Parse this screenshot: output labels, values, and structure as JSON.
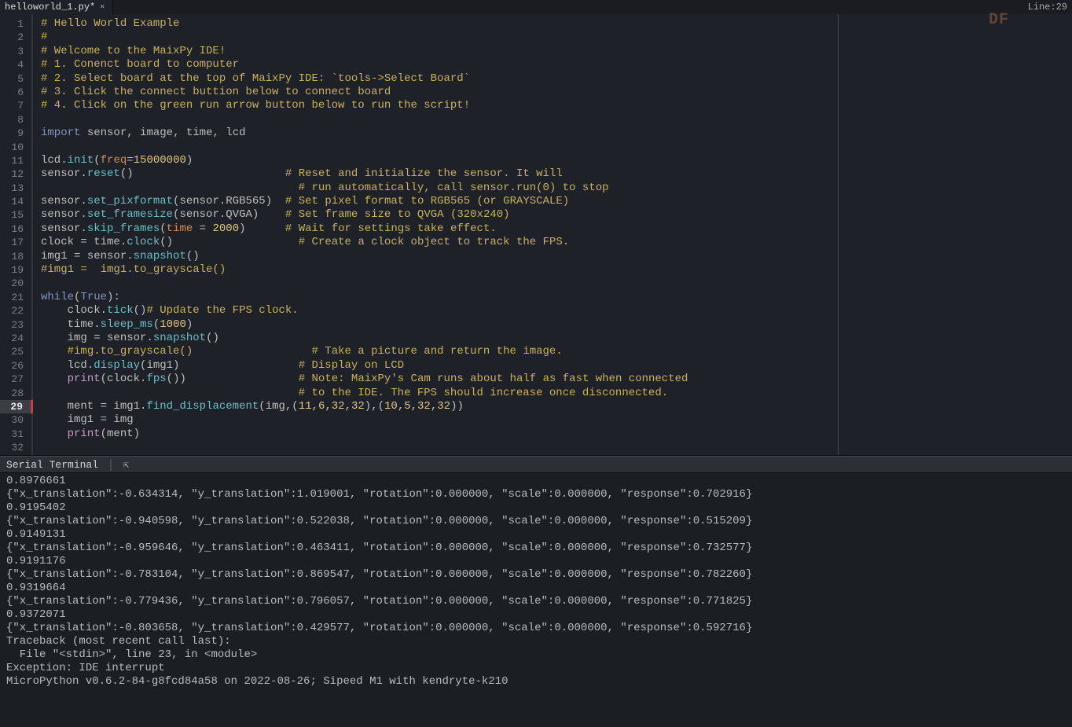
{
  "tab": {
    "title": "helloworld_1.py*"
  },
  "status": {
    "lineLabelPrefix": "Line: ",
    "lineNumber": "29"
  },
  "watermark": "DF",
  "editor": {
    "currentLine": 29,
    "foldLines": [
      12,
      21,
      25,
      27
    ],
    "lines": [
      [
        [
          "comment",
          "# Hello World Example"
        ]
      ],
      [
        [
          "comment",
          "#"
        ]
      ],
      [
        [
          "comment",
          "# Welcome to the MaixPy IDE!"
        ]
      ],
      [
        [
          "comment",
          "# 1. Conenct board to computer"
        ]
      ],
      [
        [
          "comment",
          "# 2. Select board at the top of MaixPy IDE: `tools->Select Board`"
        ]
      ],
      [
        [
          "comment",
          "# 3. Click the connect buttion below to connect board"
        ]
      ],
      [
        [
          "comment",
          "# 4. Click on the green run arrow button below to run the script!"
        ]
      ],
      [],
      [
        [
          "keyword",
          "import"
        ],
        [
          "ident",
          " sensor"
        ],
        [
          "punct",
          ","
        ],
        [
          "ident",
          " image"
        ],
        [
          "punct",
          ","
        ],
        [
          "ident",
          " time"
        ],
        [
          "punct",
          ","
        ],
        [
          "ident",
          " lcd"
        ]
      ],
      [],
      [
        [
          "ident",
          "lcd"
        ],
        [
          "punct",
          "."
        ],
        [
          "func",
          "init"
        ],
        [
          "punct",
          "("
        ],
        [
          "param",
          "freq"
        ],
        [
          "punct",
          "="
        ],
        [
          "num",
          "15000000"
        ],
        [
          "punct",
          ")"
        ]
      ],
      [
        [
          "ident",
          "sensor"
        ],
        [
          "punct",
          "."
        ],
        [
          "func",
          "reset"
        ],
        [
          "punct",
          "()"
        ],
        [
          "ident",
          "                       "
        ],
        [
          "comment",
          "# Reset and initialize the sensor. It will"
        ]
      ],
      [
        [
          "ident",
          "                                       "
        ],
        [
          "comment",
          "# run automatically, call sensor.run(0) to stop"
        ]
      ],
      [
        [
          "ident",
          "sensor"
        ],
        [
          "punct",
          "."
        ],
        [
          "func",
          "set_pixformat"
        ],
        [
          "punct",
          "("
        ],
        [
          "ident",
          "sensor"
        ],
        [
          "punct",
          "."
        ],
        [
          "ident",
          "RGB565"
        ],
        [
          "punct",
          ")"
        ],
        [
          "ident",
          "  "
        ],
        [
          "comment",
          "# Set pixel format to RGB565 (or GRAYSCALE)"
        ]
      ],
      [
        [
          "ident",
          "sensor"
        ],
        [
          "punct",
          "."
        ],
        [
          "func",
          "set_framesize"
        ],
        [
          "punct",
          "("
        ],
        [
          "ident",
          "sensor"
        ],
        [
          "punct",
          "."
        ],
        [
          "ident",
          "QVGA"
        ],
        [
          "punct",
          ")"
        ],
        [
          "ident",
          "    "
        ],
        [
          "comment",
          "# Set frame size to QVGA (320x240)"
        ]
      ],
      [
        [
          "ident",
          "sensor"
        ],
        [
          "punct",
          "."
        ],
        [
          "func",
          "skip_frames"
        ],
        [
          "punct",
          "("
        ],
        [
          "param",
          "time"
        ],
        [
          "ident",
          " "
        ],
        [
          "punct",
          "="
        ],
        [
          "ident",
          " "
        ],
        [
          "num",
          "2000"
        ],
        [
          "punct",
          ")"
        ],
        [
          "ident",
          "      "
        ],
        [
          "comment",
          "# Wait for settings take effect."
        ]
      ],
      [
        [
          "ident",
          "clock "
        ],
        [
          "punct",
          "="
        ],
        [
          "ident",
          " time"
        ],
        [
          "punct",
          "."
        ],
        [
          "func",
          "clock"
        ],
        [
          "punct",
          "()"
        ],
        [
          "ident",
          "                   "
        ],
        [
          "comment",
          "# Create a clock object to track the FPS."
        ]
      ],
      [
        [
          "ident",
          "img1 "
        ],
        [
          "punct",
          "="
        ],
        [
          "ident",
          " sensor"
        ],
        [
          "punct",
          "."
        ],
        [
          "func",
          "snapshot"
        ],
        [
          "punct",
          "()"
        ]
      ],
      [
        [
          "comment",
          "#img1 =  img1.to_grayscale()"
        ]
      ],
      [],
      [
        [
          "keyword",
          "while"
        ],
        [
          "punct",
          "("
        ],
        [
          "keyword",
          "True"
        ],
        [
          "punct",
          ")"
        ],
        [
          "punct",
          ":"
        ]
      ],
      [
        [
          "ident",
          "    clock"
        ],
        [
          "punct",
          "."
        ],
        [
          "func",
          "tick"
        ],
        [
          "punct",
          "()"
        ],
        [
          "comment",
          "# Update the FPS clock."
        ]
      ],
      [
        [
          "ident",
          "    time"
        ],
        [
          "punct",
          "."
        ],
        [
          "func",
          "sleep_ms"
        ],
        [
          "punct",
          "("
        ],
        [
          "num",
          "1000"
        ],
        [
          "punct",
          ")"
        ]
      ],
      [
        [
          "ident",
          "    img "
        ],
        [
          "punct",
          "="
        ],
        [
          "ident",
          " sensor"
        ],
        [
          "punct",
          "."
        ],
        [
          "func",
          "snapshot"
        ],
        [
          "punct",
          "()"
        ]
      ],
      [
        [
          "ident",
          "    "
        ],
        [
          "comment",
          "#img.to_grayscale()"
        ],
        [
          "ident",
          "                  "
        ],
        [
          "comment",
          "# Take a picture and return the image."
        ]
      ],
      [
        [
          "ident",
          "    lcd"
        ],
        [
          "punct",
          "."
        ],
        [
          "func",
          "display"
        ],
        [
          "punct",
          "("
        ],
        [
          "ident",
          "img1"
        ],
        [
          "punct",
          ")"
        ],
        [
          "ident",
          "                  "
        ],
        [
          "comment",
          "# Display on LCD"
        ]
      ],
      [
        [
          "ident",
          "    "
        ],
        [
          "builtin",
          "print"
        ],
        [
          "punct",
          "("
        ],
        [
          "ident",
          "clock"
        ],
        [
          "punct",
          "."
        ],
        [
          "func",
          "fps"
        ],
        [
          "punct",
          "()"
        ],
        [
          "punct",
          ")"
        ],
        [
          "ident",
          "                 "
        ],
        [
          "comment",
          "# Note: MaixPy's Cam runs about half as fast when connected"
        ]
      ],
      [
        [
          "ident",
          "                                       "
        ],
        [
          "comment",
          "# to the IDE. The FPS should increase once disconnected."
        ]
      ],
      [
        [
          "ident",
          "    ment "
        ],
        [
          "punct",
          "="
        ],
        [
          "ident",
          " img1"
        ],
        [
          "punct",
          "."
        ],
        [
          "func",
          "find_displacement"
        ],
        [
          "punct",
          "("
        ],
        [
          "ident",
          "img"
        ],
        [
          "punct",
          ",("
        ],
        [
          "num",
          "11"
        ],
        [
          "punct",
          ","
        ],
        [
          "num",
          "6"
        ],
        [
          "punct",
          ","
        ],
        [
          "num",
          "32"
        ],
        [
          "punct",
          ","
        ],
        [
          "num",
          "32"
        ],
        [
          "punct",
          "),("
        ],
        [
          "num",
          "10"
        ],
        [
          "punct",
          ","
        ],
        [
          "num",
          "5"
        ],
        [
          "punct",
          ","
        ],
        [
          "num",
          "32"
        ],
        [
          "punct",
          ","
        ],
        [
          "num",
          "32"
        ],
        [
          "punct",
          "))"
        ]
      ],
      [
        [
          "ident",
          "    img1 "
        ],
        [
          "punct",
          "="
        ],
        [
          "ident",
          " img"
        ]
      ],
      [
        [
          "ident",
          "    "
        ],
        [
          "builtin",
          "print"
        ],
        [
          "punct",
          "("
        ],
        [
          "ident",
          "ment"
        ],
        [
          "punct",
          ")"
        ]
      ],
      []
    ]
  },
  "terminal": {
    "title": "Serial Terminal",
    "lines": [
      "0.8976661",
      "{\"x_translation\":-0.634314, \"y_translation\":1.019001, \"rotation\":0.000000, \"scale\":0.000000, \"response\":0.702916}",
      "0.9195402",
      "{\"x_translation\":-0.940598, \"y_translation\":0.522038, \"rotation\":0.000000, \"scale\":0.000000, \"response\":0.515209}",
      "0.9149131",
      "{\"x_translation\":-0.959646, \"y_translation\":0.463411, \"rotation\":0.000000, \"scale\":0.000000, \"response\":0.732577}",
      "0.9191176",
      "{\"x_translation\":-0.783104, \"y_translation\":0.869547, \"rotation\":0.000000, \"scale\":0.000000, \"response\":0.782260}",
      "0.9319664",
      "{\"x_translation\":-0.779436, \"y_translation\":0.796057, \"rotation\":0.000000, \"scale\":0.000000, \"response\":0.771825}",
      "0.9372071",
      "{\"x_translation\":-0.803658, \"y_translation\":0.429577, \"rotation\":0.000000, \"scale\":0.000000, \"response\":0.592716}",
      "",
      "Traceback (most recent call last):",
      "  File \"<stdin>\", line 23, in <module>",
      "Exception: IDE interrupt",
      "MicroPython v0.6.2-84-g8fcd84a58 on 2022-08-26; Sipeed M1 with kendryte-k210"
    ]
  }
}
